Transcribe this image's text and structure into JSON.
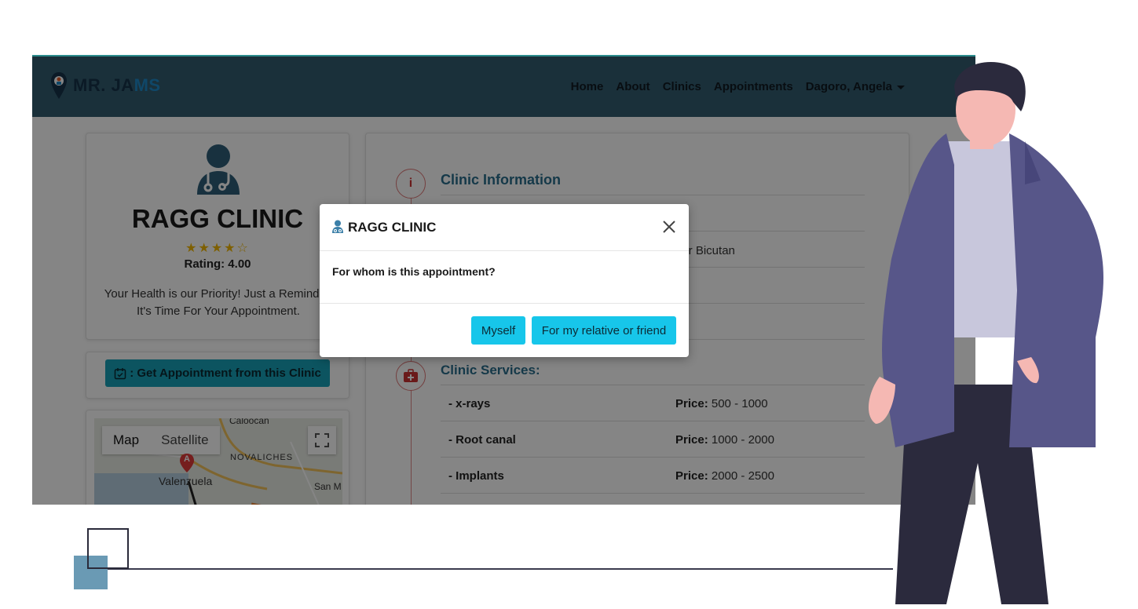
{
  "nav": {
    "logo_main": "MR. JA",
    "logo_accent": "MS",
    "links": [
      "Home",
      "About",
      "Clinics",
      "Appointments"
    ],
    "user": "Dagoro, Angela"
  },
  "clinic": {
    "name": "RAGG CLINIC",
    "stars": "★★★★☆",
    "rating_label": "Rating: 4.00",
    "tagline": "Your Health is our Priority! Just a Reminder, It's Time For Your Appointment.",
    "cta_label": ": Get Appointment from this Clinic"
  },
  "map": {
    "tab_map": "Map",
    "tab_satellite": "Satellite",
    "places": [
      "Caloocan",
      "NOVALICHES",
      "Valenzuela",
      "San M",
      "A"
    ]
  },
  "info": {
    "section_info": "Clinic Information",
    "address_fragment": "per Bicutan",
    "section_services": "Clinic Services:",
    "price_label": "Price:",
    "services": [
      {
        "name": "- x-rays",
        "price": "500 - 1000"
      },
      {
        "name": "- Root canal",
        "price": "1000 - 2000"
      },
      {
        "name": "- Implants",
        "price": "2000 - 2500"
      }
    ]
  },
  "modal": {
    "title": "RAGG CLINIC",
    "question": "For whom is this appointment?",
    "btn_myself": "Myself",
    "btn_relative": "For my relative or friend"
  },
  "colors": {
    "navbar": "#335c70",
    "accent_button": "#17c6ea",
    "cta_button": "#17a2b8",
    "section_title": "#2a6d8c",
    "star": "#f1b600"
  }
}
